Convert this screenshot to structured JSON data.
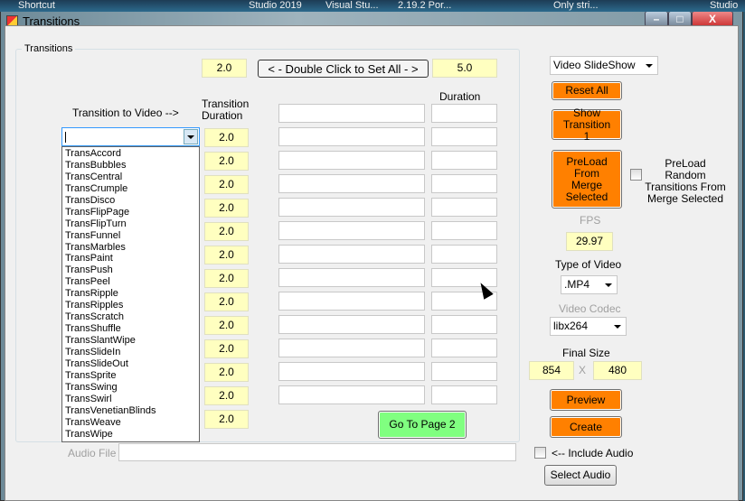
{
  "taskbar": [
    "Shortcut",
    "Studio 2019",
    "Visual Stu...",
    "2.19.2 Por...",
    "Only stri...",
    "Studio"
  ],
  "window": {
    "title": "Transitions",
    "min": "–",
    "max": "□",
    "close": "X"
  },
  "group_label": "Transitions",
  "set_all": {
    "duration": "2.0",
    "button": "< - Double Click to Set All - >",
    "duration2": "5.0"
  },
  "headers": {
    "transition_to_video": "Transition to Video -->",
    "transition_duration": "Transition Duration",
    "duration": "Duration"
  },
  "durations": [
    "2.0",
    "2.0",
    "2.0",
    "2.0",
    "2.0",
    "2.0",
    "2.0",
    "2.0",
    "2.0",
    "2.0",
    "2.0",
    "2.0",
    "2.0"
  ],
  "combo_value": "",
  "dropdown_items": [
    "TransAccord",
    "TransBubbles",
    "TransCentral",
    "TransCrumple",
    "TransDisco",
    "TransFlipPage",
    "TransFlipTurn",
    "TransFunnel",
    "TransMarbles",
    "TransPaint",
    "TransPush",
    "TransPeel",
    "TransRipple",
    "TransRipples",
    "TransScratch",
    "TransShuffle",
    "TransSlantWipe",
    "TransSlideIn",
    "TransSlideOut",
    "TransSprite",
    "TransSwing",
    "TransSwirl",
    "TransVenetianBlinds",
    "TransWeave",
    "TransWipe"
  ],
  "go_page2": "Go To Page 2",
  "audio": {
    "label": "Audio File",
    "value": "",
    "include": "<-- Include Audio",
    "select": "Select Audio"
  },
  "right": {
    "mode": "Video SlideShow",
    "reset": "Reset All",
    "show": "Show Transition 1",
    "preload": "PreLoad From Merge Selected",
    "preload_random": "PreLoad Random Transitions From Merge Selected",
    "fps_label": "FPS",
    "fps": "29.97",
    "type_label": "Type of Video",
    "type": ".MP4",
    "codec_label": "Video Codec",
    "codec": "libx264",
    "size_label": "Final Size",
    "width": "854",
    "x": "X",
    "height": "480",
    "preview": "Preview",
    "create": "Create"
  },
  "colors": {
    "orange": "#ff8000",
    "green": "#80ff80",
    "yellow": "#ffffc0"
  }
}
